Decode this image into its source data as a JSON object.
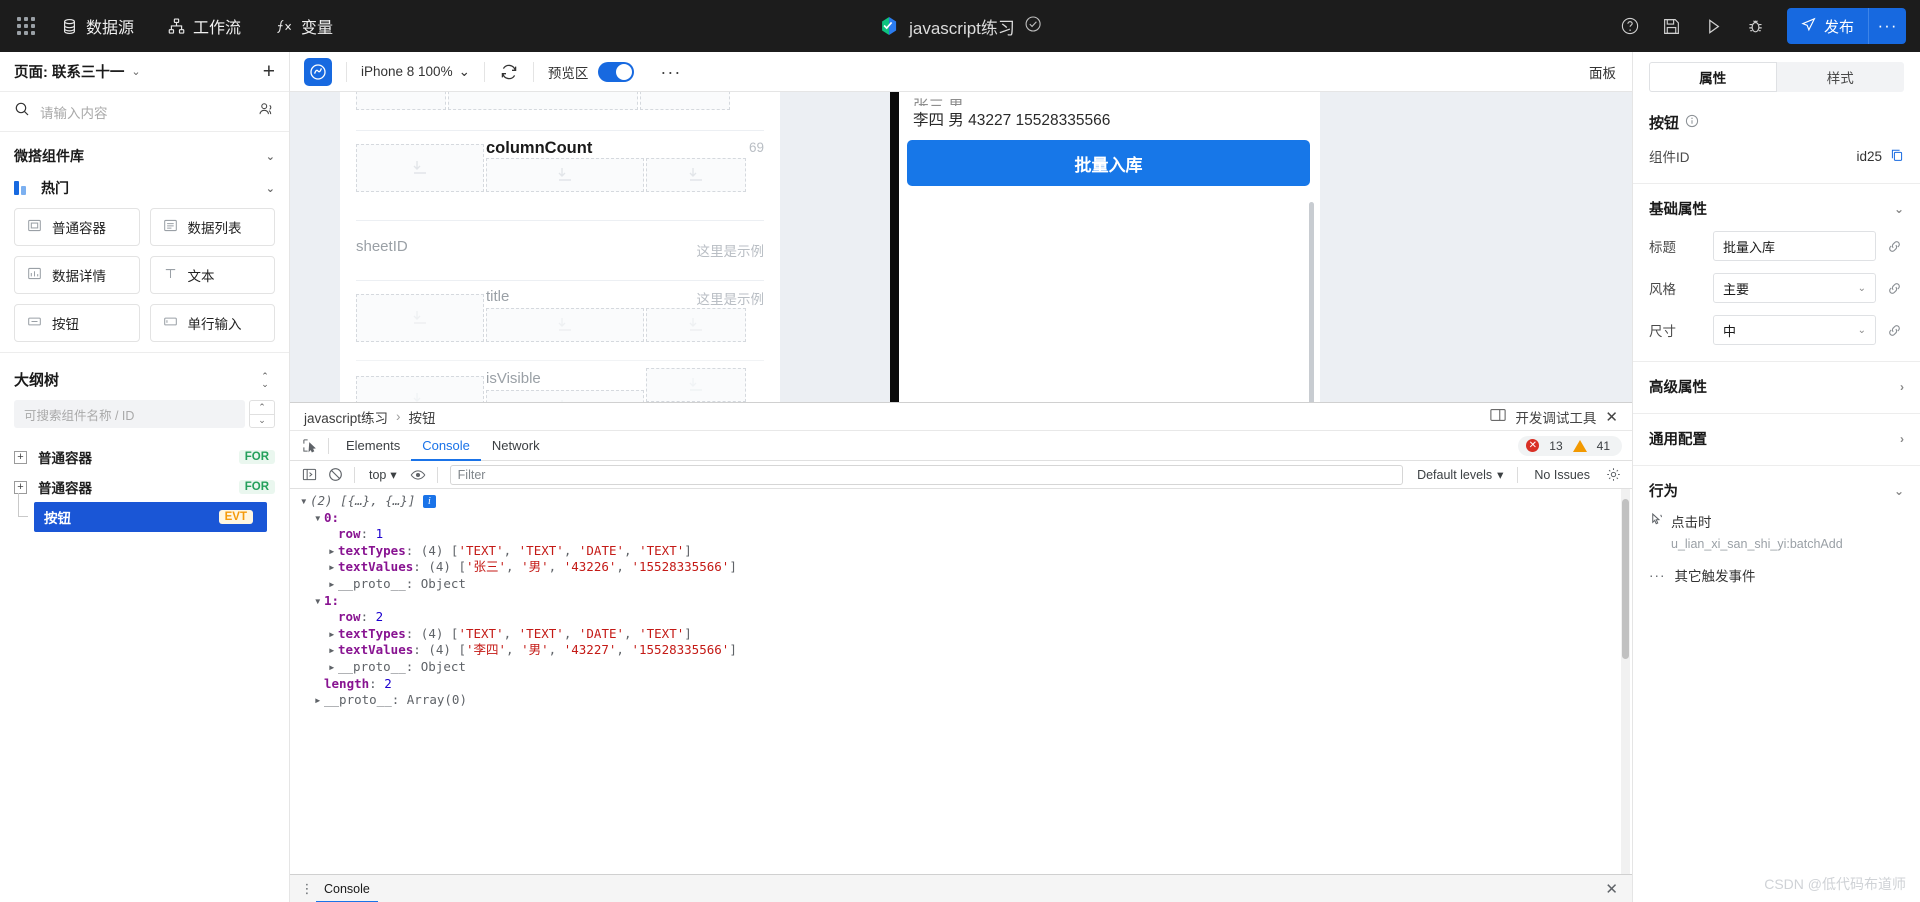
{
  "topbar": {
    "nav": [
      {
        "label": "数据源",
        "icon": "database-icon"
      },
      {
        "label": "工作流",
        "icon": "workflow-icon"
      },
      {
        "label": "变量",
        "icon": "fx-icon"
      }
    ],
    "project_title": "javascript练习",
    "status_icon": "check-circle-icon",
    "icons": [
      "help-icon",
      "save-icon",
      "play-icon",
      "debug-icon"
    ],
    "publish_label": "发布",
    "publish_more": "···",
    "accent": "#1769e0",
    "bg": "#1c1c1c"
  },
  "left": {
    "page_label": "页面: 联系三十一",
    "add_button": "+",
    "search_placeholder": "请输入内容",
    "library_title": "微搭组件库",
    "category": "热门",
    "components": [
      {
        "label": "普通容器",
        "icon": "container-icon"
      },
      {
        "label": "数据列表",
        "icon": "list-icon"
      },
      {
        "label": "数据详情",
        "icon": "detail-icon"
      },
      {
        "label": "文本",
        "icon": "text-icon"
      },
      {
        "label": "按钮",
        "icon": "button-icon"
      },
      {
        "label": "单行输入",
        "icon": "input-icon"
      }
    ],
    "outline_title": "大纲树",
    "tree_search_placeholder": "可搜索组件名称 / ID",
    "tree": [
      {
        "label": "普通容器",
        "tag": "FOR",
        "tag_type": "for",
        "selected": false,
        "child": false
      },
      {
        "label": "普通容器",
        "tag": "FOR",
        "tag_type": "for",
        "selected": false,
        "child": false
      },
      {
        "label": "按钮",
        "tag": "EVT",
        "tag_type": "evt",
        "selected": true,
        "child": true
      }
    ]
  },
  "canvas": {
    "device": "iPhone 8 100%",
    "preview_label": "预览区",
    "preview_on": true,
    "more": "···",
    "panel_label": "面板",
    "fields": [
      {
        "name": "columnCount",
        "value": "69",
        "strong": true
      },
      {
        "name": "sheetID",
        "value": "这里是示例",
        "strong": false
      },
      {
        "name": "title",
        "value": "这里是示例",
        "strong": false
      },
      {
        "name": "isVisible",
        "value": "",
        "strong": false
      }
    ],
    "phone": {
      "row_partial": "张三 男",
      "row_text": "李四 男 43227 15528335566",
      "button_label": "批量入库"
    }
  },
  "devtools": {
    "breadcrumb": [
      "javascript练习",
      "按钮"
    ],
    "panel_title": "开发调试工具",
    "close": "✕",
    "tabs": [
      {
        "label": "Elements",
        "active": false
      },
      {
        "label": "Console",
        "active": true
      },
      {
        "label": "Network",
        "active": false
      }
    ],
    "error_count": "13",
    "warning_count": "41",
    "context": "top",
    "filter_placeholder": "Filter",
    "levels": "Default levels",
    "issues": "No Issues",
    "drawer_tab": "Console",
    "console": {
      "header": "(2) [{…}, {…}]",
      "entries": [
        {
          "index": "0:",
          "row_key": "row",
          "row_val": "1",
          "textTypes_label": "textTypes",
          "textTypes_count": "(4)",
          "textTypes": [
            "'TEXT'",
            "'TEXT'",
            "'DATE'",
            "'TEXT'"
          ],
          "textValues_label": "textValues",
          "textValues_count": "(4)",
          "textValues": [
            "'张三'",
            "'男'",
            "'43226'",
            "'15528335566'"
          ],
          "proto": "__proto__: Object"
        },
        {
          "index": "1:",
          "row_key": "row",
          "row_val": "2",
          "textTypes_label": "textTypes",
          "textTypes_count": "(4)",
          "textTypes": [
            "'TEXT'",
            "'TEXT'",
            "'DATE'",
            "'TEXT'"
          ],
          "textValues_label": "textValues",
          "textValues_count": "(4)",
          "textValues": [
            "'李四'",
            "'男'",
            "'43227'",
            "'15528335566'"
          ],
          "proto": "__proto__: Object"
        }
      ],
      "length_key": "length",
      "length_val": "2",
      "array_proto": "__proto__: Array(0)"
    }
  },
  "right": {
    "tabs": [
      {
        "label": "属性",
        "active": true
      },
      {
        "label": "样式",
        "active": false
      }
    ],
    "section_title": "按钮",
    "component_id_label": "组件ID",
    "component_id_value": "id25",
    "groups": {
      "basic": "基础属性",
      "advanced": "高级属性",
      "common": "通用配置",
      "behavior": "行为"
    },
    "fields": [
      {
        "label": "标题",
        "value": "批量入库",
        "type": "input"
      },
      {
        "label": "风格",
        "value": "主要",
        "type": "select"
      },
      {
        "label": "尺寸",
        "value": "中",
        "type": "select"
      }
    ],
    "event": {
      "trigger_label": "点击时",
      "handler": "u_lian_xi_san_shi_yi:batchAdd",
      "more_label": "其它触发事件"
    }
  },
  "watermark": "CSDN @低代码布道师"
}
